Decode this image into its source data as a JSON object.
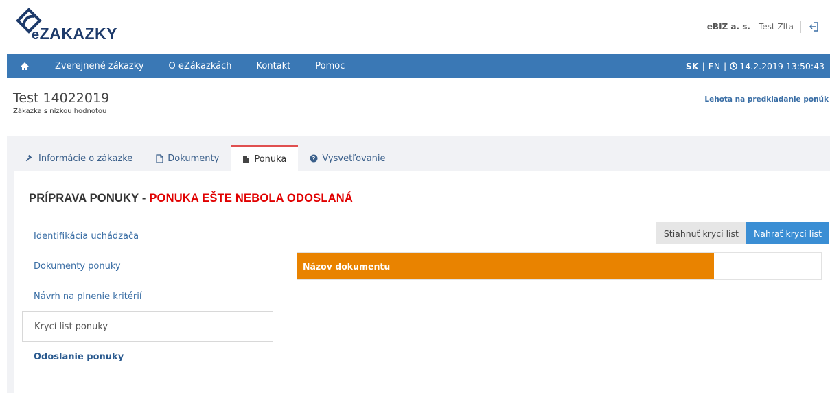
{
  "header": {
    "logo_prefix": "e",
    "logo_main": "ZAKAZKY",
    "company": "eBIZ a. s.",
    "user_sep": " - ",
    "user": "Test Zlta"
  },
  "nav": {
    "items": [
      "Zverejnené zákazky",
      "O eZákazkách",
      "Kontakt",
      "Pomoc"
    ],
    "lang_sk": "SK",
    "lang_en": "EN",
    "datetime": "14.2.2019 13:50:43"
  },
  "page": {
    "title": "Test 14022019",
    "subtitle": "Zákazka s nízkou hodnotou",
    "deadline_link": "Lehota na predkladanie ponúk"
  },
  "tabs": [
    "Informácie o zákazke",
    "Dokumenty",
    "Ponuka",
    "Vysvetľovanie"
  ],
  "section": {
    "title": "PRÍPRAVA PONUKY - ",
    "status": "PONUKA EŠTE NEBOLA ODOSLANÁ"
  },
  "side_menu": [
    "Identifikácia uchádzača",
    "Dokumenty ponuky",
    "Návrh na plnenie kritérií",
    "Krycí list ponuky",
    "Odoslanie ponuky"
  ],
  "buttons": {
    "download": "Stiahnuť krycí list",
    "upload": "Nahrať krycí list"
  },
  "table": {
    "header": "Názov dokumentu"
  },
  "colors": {
    "nav_bg": "#3a78b5",
    "accent_orange": "#e98300",
    "status_red": "#e00000",
    "button_blue": "#3a8ed4"
  }
}
